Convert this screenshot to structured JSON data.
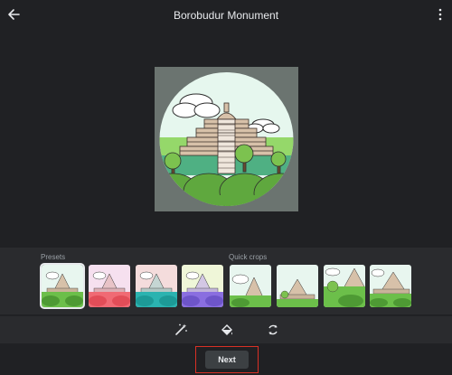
{
  "header": {
    "title": "Borobudur Monument",
    "back_icon": "arrow-back-icon",
    "more_icon": "more-vert-icon"
  },
  "tray": {
    "presets_label": "Presets",
    "quick_crops_label": "Quick crops",
    "presets": [
      {
        "name": "original",
        "selected": true
      },
      {
        "name": "pink"
      },
      {
        "name": "teal"
      },
      {
        "name": "purple"
      }
    ],
    "quick_crops": [
      {
        "name": "crop-1"
      },
      {
        "name": "crop-2"
      },
      {
        "name": "crop-3"
      },
      {
        "name": "crop-4"
      }
    ]
  },
  "tools": [
    "auto-enhance-icon",
    "paint-bucket-icon",
    "rotate-icon"
  ],
  "footer": {
    "next_label": "Next"
  },
  "colors": {
    "background": "#202124",
    "tray": "#2a2b2e",
    "highlight_border": "#d93025",
    "sky": "#e6f7ee",
    "grass": "#7cc24f",
    "stone": "#d7c1a9"
  }
}
